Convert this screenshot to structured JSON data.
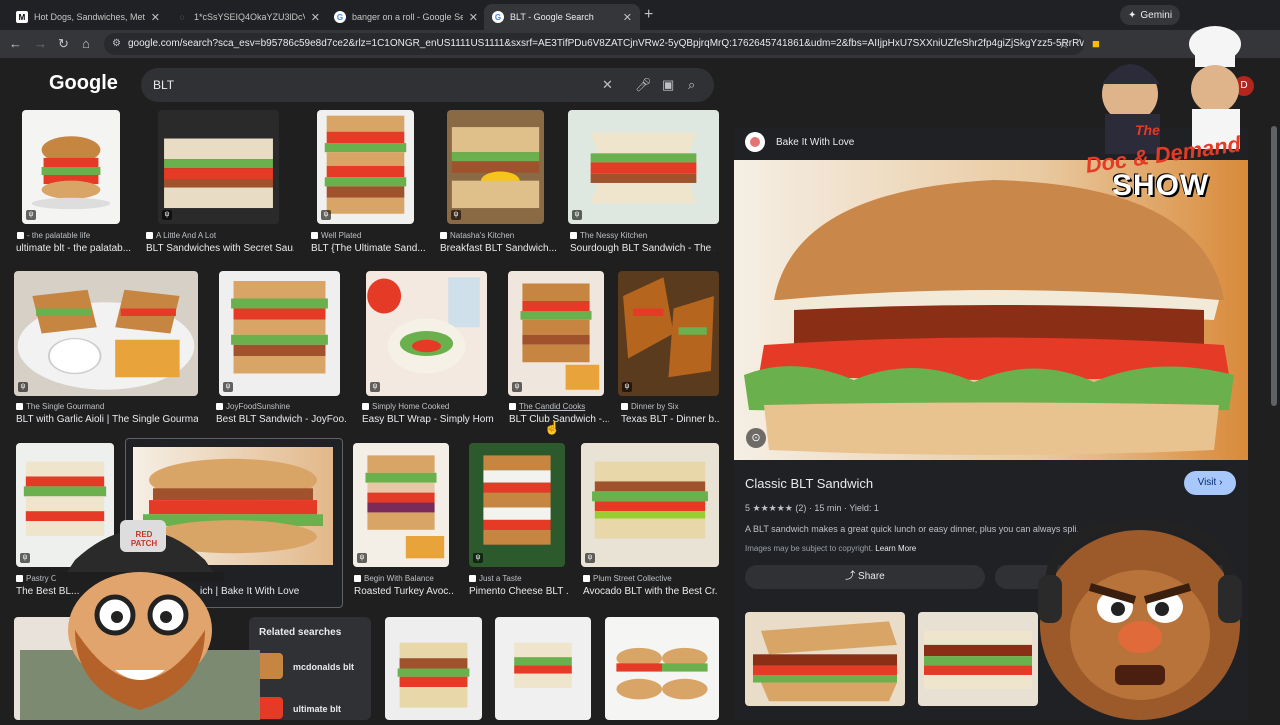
{
  "tabs": [
    {
      "label": "Hot Dogs, Sandwiches, Metaph",
      "fav": "M",
      "color": "#e8eaed"
    },
    {
      "label": "1*cSsYSEIQ4OkaYZU3lDcVLQ.jp",
      "fav": "◌",
      "color": "#9aa0a6"
    },
    {
      "label": "banger on a roll - Google Sear",
      "fav": "G",
      "color": "#4285f4"
    },
    {
      "label": "BLT - Google Search",
      "fav": "G",
      "color": "#4285f4"
    }
  ],
  "gemini_label": "Gemini",
  "url": "google.com/search?sca_esv=b95786c59e8d7ce2&rlz=1C1ONGR_enUS1111US1111&sxsrf=AE3TifPDu6V8ZATCjnVRw2-5yQBpjrqMrQ:1762645741861&udm=2&fbs=AIIjpHxU7SXXniUZfeShr2fp4giZjSkgYzz5-5RrRWAInlWd7t...",
  "logo": "Google",
  "search_query": "BLT",
  "profile_initial": "D",
  "image_results": [
    {
      "src": "- the palatable life",
      "title": "ultimate blt - the palatab..."
    },
    {
      "src": "A Little And A Lot",
      "title": "BLT Sandwiches with Secret Sau..."
    },
    {
      "src": "Well Plated",
      "title": "BLT {The Ultimate Sand..."
    },
    {
      "src": "Natasha's Kitchen",
      "title": "Breakfast BLT Sandwich..."
    },
    {
      "src": "The Nessy Kitchen",
      "title": "Sourdough BLT Sandwich - The ..."
    },
    {
      "src": "The Single Gourmand",
      "title": "BLT with Garlic Aioli | The Single Gourma..."
    },
    {
      "src": "JoyFoodSunshine",
      "title": "Best BLT Sandwich - JoyFoo..."
    },
    {
      "src": "Simply Home Cooked",
      "title": "Easy BLT Wrap - Simply Hom..."
    },
    {
      "src": "The Candid Cooks",
      "title": "BLT Club Sandwich -..."
    },
    {
      "src": "Dinner by Six",
      "title": "Texas BLT - Dinner b..."
    },
    {
      "src": "Pastry Chef",
      "title": "The Best BL..."
    },
    {
      "src": "",
      "title": "ich | Bake It With Love"
    },
    {
      "src": "Begin With Balance",
      "title": "Roasted Turkey Avoc..."
    },
    {
      "src": "Just a Taste",
      "title": "Pimento Cheese BLT ..."
    },
    {
      "src": "Plum Street Collective",
      "title": "Avocado BLT with the Best Cr..."
    }
  ],
  "related": {
    "heading": "Related searches",
    "items": [
      "mcdonalds blt",
      "ultimate blt"
    ]
  },
  "panel": {
    "source": "Bake It With Love",
    "title": "Classic BLT Sandwich",
    "rating": "5 ★★★★★ (2)  ·  15 min  ·  Yield: 1",
    "description": "A BLT sandwich makes a great quick lunch or easy dinner, plus you can always spli...",
    "copyright": "Images may be subject to copyright.",
    "learn_more": "Learn More",
    "visit_label": "Visit",
    "share_label": "Share"
  },
  "overlay": {
    "cap_text": "RED PATCH",
    "show_line1": "The",
    "show_line2": "Doc & Demand",
    "show_line3": "SHOW"
  },
  "colors": {
    "accent": "#a8c7fa",
    "bg": "#1f1f1f",
    "tomato": "#e53a25",
    "lettuce": "#6ab04c",
    "bread": "#d9a566"
  }
}
